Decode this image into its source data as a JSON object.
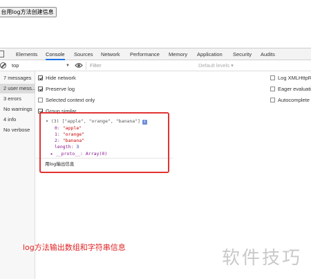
{
  "page": {
    "button_label": "台用log方法创建信息"
  },
  "devtools": {
    "tabs": [
      {
        "label": "Elements"
      },
      {
        "label": "Console"
      },
      {
        "label": "Sources"
      },
      {
        "label": "Network"
      },
      {
        "label": "Performance"
      },
      {
        "label": "Memory"
      },
      {
        "label": "Application"
      },
      {
        "label": "Security"
      },
      {
        "label": "Audits"
      }
    ],
    "active_tab": "Console",
    "context": "top",
    "filter_placeholder": "Filter",
    "levels": "Default levels ▾"
  },
  "sidebar": {
    "items": [
      {
        "label": "7 messages"
      },
      {
        "label": "2 user mess..."
      },
      {
        "label": "3 errors"
      },
      {
        "label": "No warnings"
      },
      {
        "label": "4 info"
      },
      {
        "label": "No verbose"
      }
    ],
    "selected": "2 user mess..."
  },
  "settings": {
    "hide_network": {
      "label": "Hide network",
      "checked": true
    },
    "preserve_log": {
      "label": "Preserve log",
      "checked": true
    },
    "selected_context": {
      "label": "Selected context only",
      "checked": false
    },
    "group_similar": {
      "label": "Group similar",
      "checked": true
    },
    "log_xhr": {
      "label": "Log XMLHttpR",
      "checked": false
    },
    "eager_eval": {
      "label": "Eager evaluatio",
      "checked": false
    },
    "autocomplete": {
      "label": "Autocomplete",
      "checked": false
    }
  },
  "console": {
    "array_header": "▾ (3) [\"apple\", \"orange\", \"banana\"]",
    "info_badge": "i",
    "entries": [
      {
        "index": "0",
        "value": "\"apple\""
      },
      {
        "index": "1",
        "value": "\"orange\""
      },
      {
        "index": "2",
        "value": "\"banana\""
      }
    ],
    "length_key": "length",
    "length_value": "3",
    "proto_line": "▸ __proto__: Array(0)",
    "log_message": "用log输出信息",
    "prompt": "›"
  },
  "annotation": {
    "caption": "log方法输出数组和字符串信息",
    "watermark": "软件技巧"
  }
}
